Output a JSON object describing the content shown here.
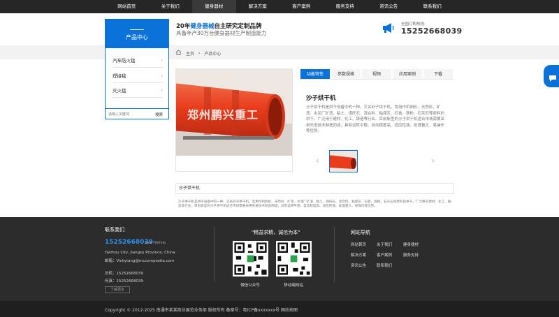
{
  "nav": {
    "items": [
      "网站首页",
      "关于我们",
      "健身器材",
      "解决方案",
      "客户案例",
      "服务支持",
      "资讯公告",
      "联系我们"
    ],
    "active_index": 2
  },
  "sidebar": {
    "title": "产品中心",
    "items": [
      {
        "label": "汽车防火毯"
      },
      {
        "label": "焊接毯"
      },
      {
        "label": "灭火毯"
      }
    ],
    "search_placeholder": "请输入关键词",
    "search_button": "搜索"
  },
  "header": {
    "slogan_prefix": "20年",
    "slogan_highlight": "健身器械",
    "slogan_suffix": "自主研究定制品牌",
    "slogan_sub": "具备年产30万台健身器材生产制造能力",
    "hotline_label": "全国订购热线:",
    "hotline": "15252668039"
  },
  "breadcrumb": {
    "home": "主页",
    "sep": "›",
    "current": "产品中心"
  },
  "product": {
    "watermark": "郑州鹏兴重工",
    "tabs": [
      "功能特性",
      "参数规格",
      "视频",
      "应用案例",
      "下载"
    ],
    "active_tab": 0,
    "title": "沙子烘干机",
    "description": "沙子烘干机是烘干设备中的一种，又名砂子烘干机。常用作机制砂、天然砂、矿渣、水泥厂矿渣、粘土、煤矸石、混合料、粘煤灰、石膏、铁粉、石灰石等原料的烘干。广泛用于建材、化工、铸造等行业。目前新型的沙子烘干机适合市场需要采用先进技术制造而成，具有运转平稳、自动程度高、适应性强、处理量大、易操作等优势。"
  },
  "detail": {
    "heading": "沙子烘干机",
    "body": "沙子烘干机是烘干设备中的一种，又名砂子烘干机。常用作机制砂、天然砂、矿渣、水泥厂矿渣、粘土、煤矸石、混合料、粘煤灰、石膏、铁粉、石灰石等原料的烘干。广泛用于建材、化工、铸造等行业。目前新型的沙子烘干机适合市场需要采用先进技术制造而成，具有运转平稳、自动程度高、适应性强、处理量大、易操作等优势。"
  },
  "footer": {
    "contact_title": "联系我们",
    "phone": "15252668039",
    "hotline_tag": "Sale Hotline",
    "address": "Taizhou City, Jiangsu Province, China",
    "email_label": "邮箱：",
    "email": "Vickytang@mccomposite.com",
    "tel_label": "总机：",
    "tel": "15252668039",
    "fax_label": "传真：",
    "fax": "15252668039",
    "more_button": "了解更多",
    "slogan": "\"精益求精，诚信为本\"",
    "qr1_caption": "微信公众号",
    "qr2_caption": "移动端网站",
    "nav_title": "网站导航",
    "nav_items": [
      "网站首页",
      "关于我们",
      "健身器材",
      "解决方案",
      "客户案例",
      "服务支持",
      "资讯公告",
      "联系我们"
    ],
    "copyright": "Copyright © 2012-2025 南通市某某商业展览业务部 版权所有 备案号：粤ICP备xxxxxxx号 网站地图"
  },
  "colors": {
    "accent": "#0a72d8",
    "topbar": "#262626",
    "footer": "#2c2c2c",
    "product": "#e63b1e"
  }
}
